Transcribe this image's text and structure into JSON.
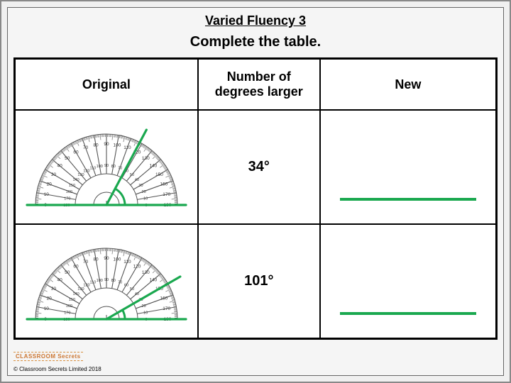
{
  "title": "Varied Fluency 3",
  "instruction": "Complete the table.",
  "headers": {
    "col1": "Original",
    "col2": "Number of degrees larger",
    "col3": "New"
  },
  "rows": [
    {
      "original_angle_deg": 62,
      "increase": "34°",
      "new": ""
    },
    {
      "original_angle_deg": 30,
      "increase": "101°",
      "new": ""
    }
  ],
  "copyright": "© Classroom Secrets Limited 2018",
  "logo_text": "CLASSROOM Secrets"
}
